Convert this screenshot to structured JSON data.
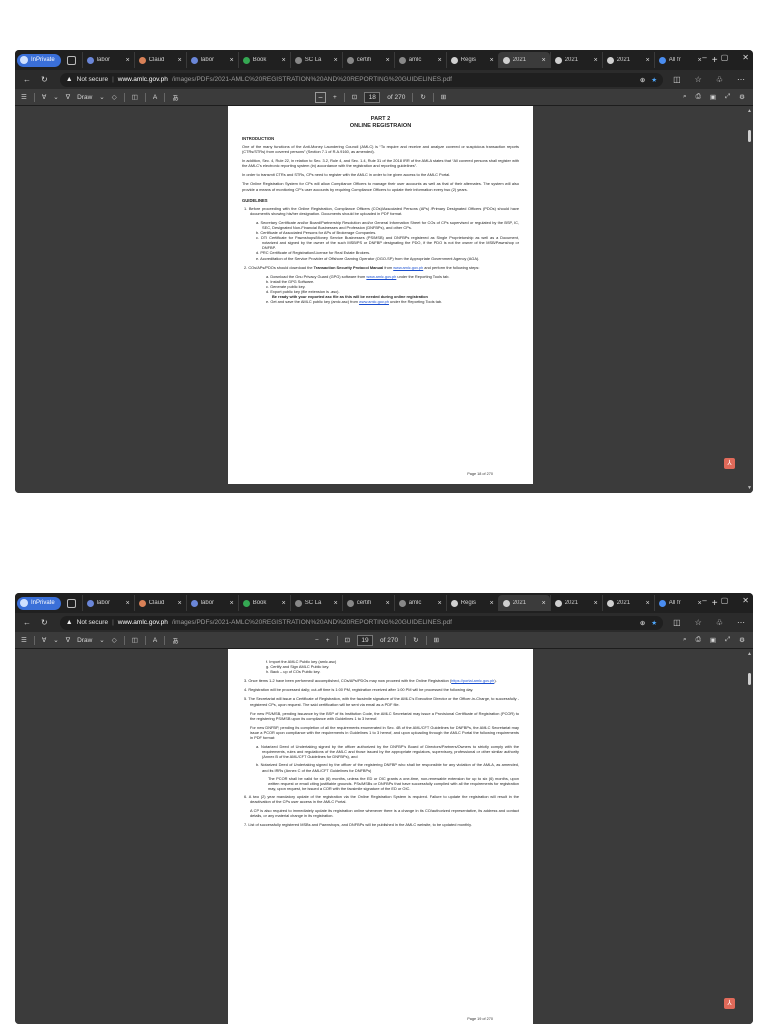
{
  "browser": {
    "profile_label": "InPrivate",
    "tabs": [
      {
        "title": "labor",
        "color": "#6a86d8"
      },
      {
        "title": "Claud",
        "color": "#d98157"
      },
      {
        "title": "labor",
        "color": "#6a86d8"
      },
      {
        "title": "Book",
        "color": "#35a853"
      },
      {
        "title": "SC La",
        "color": "#888888"
      },
      {
        "title": "certifi",
        "color": "#888888"
      },
      {
        "title": "amlc",
        "color": "#888888"
      },
      {
        "title": "Regis",
        "color": "#d0d0d0"
      },
      {
        "title": "2021",
        "color": "#d0d0d0"
      },
      {
        "title": "2021",
        "color": "#d0d0d0"
      },
      {
        "title": "2021",
        "color": "#d0d0d0"
      },
      {
        "title": "All fr",
        "color": "#4a8df0"
      }
    ],
    "new_tab": "+",
    "tab_close": "×",
    "win_min": "–",
    "win_max": "▢",
    "win_close": "✕",
    "not_secure": "Not secure",
    "url_host": "www.amlc.gov.ph",
    "url_path": "/images/PDFs/2021-AMLC%20REGISTRATION%20AND%20REPORTING%20GUIDELINES.pdf"
  },
  "pdf_toolbar": {
    "draw_label": "Draw",
    "zoom_out": "−",
    "zoom_in": "+",
    "page_of_top": "of 270",
    "page_of_bottom": "of 270",
    "current_page_top": "18",
    "current_page_bottom": "19"
  },
  "page18": {
    "part": "PART 2",
    "title": "ONLINE REGISTRAION",
    "intro_heading": "INTRODUCTION",
    "intro_p1": "One of the many functions of the Anti-Money Laundering Council (AMLC) is “To require and receive and analyze covered or suspicious transaction reports (CTRs/STRs) from covered persons” (Section 7.1 of R.A.9160, as amended).",
    "intro_p2": "In addition, Sec. 4, Rule 22, in relation to Sec. 3.2, Rule 4, and Sec. 1.4, Rule 31 of the 2018 IRR of the AMLA states that “All covered persons shall register with the AMLC’s electronic reporting system (in) accordance with the registration and reporting guidelines”.",
    "intro_p3": "In order to transmit CTRs and STRs, CPs need to register with the AMLC in order to be given access to the AMLC Portal.",
    "intro_p4": "The Online Registration System for CPs will allow Compliance Officers to manage their user accounts as well as that of their alternates. The system will also provide a means of monitoring CP’s user accounts by requiring Compliance Officers to update their information every two (2) years.",
    "guide_heading": "GUIDELINES",
    "g1": "1.  Before proceeding with the Online Registration, Compliance Officers (COs)/Associated Persons (APs) /Primary Designated Officers (PDOs) should have document/s showing his/her designation. Documents should be uploaded in PDF format.",
    "g1a": "a.  Secretary Certificate and/or Board/Partnership Resolution and/or General Information Sheet for COs of CPs supervised or regulated by the BSP, IC, SEC, Designated Non-Financial Businesses and Profession (DNFBPs), and other CPs.",
    "g1b": "b.  Certificate of Associated Persons for APs of Brokerage Companies.",
    "g1c": "c.  DTI Certificate for Pawnshops/Money Service Businesses (PS/MSB) and DNFBPs registered as Single Proprietorship as well as a Document, notarized and signed by the owner of the such MSB/PS or DNFBP designating the PDO, if the PDO is not the owner of the MSB/Pawnshop or DNFBP.",
    "g1d": "d.  PRC Certificate of Registration/License for Real Estate Brokers.",
    "g1e": "e.  Accreditation of the Service Provider of Offshore Gaming Operator (OGO-SP) from the Appropriate Government Agency (AGA).",
    "g2_pre": "2.  COs/APs/PDOs should download the ",
    "g2_bold": "Transaction Security Protocol Manual",
    "g2_mid": " from ",
    "g2_link": "www.amlc.gov.ph",
    "g2_post": " and perform the following steps:",
    "g2a_pre": "a.  Download the Gnu Privacy Guard (GPG) software from ",
    "g2a_link": "www.amlc.gov.ph",
    "g2a_post": " under the Reporting Tools tab.",
    "g2b": "b.  Install the GPG Software.",
    "g2c": "c.  Generate public key.",
    "g2d": "d.  Export public key (file extension is .asc).",
    "g2d_bold": "Be ready with your exported asc file as this will be needed during online registration",
    "g2e_pre": "e.  Get and save the AMLC public key (amlc.asc) from ",
    "g2e_link": "www.amlc.gov.ph",
    "g2e_post": " under the Reporting Tools tab.",
    "page_footer": "Page 18 of 270"
  },
  "page19": {
    "f": "f.  Import the AMLC Public key (amlc.asc)",
    "g": "g.  Certify and Sign AMLC Public key.",
    "h": "h.  Back – up of COs Public key.",
    "s3_pre": "3.  Once items 1-2 have been performed/ accomplished, COs/APs/PDOs may now proceed with the Online Registration (",
    "s3_link": "https://portal.amlc.gov.ph",
    "s3_post": ").",
    "s4": "4.  Registration will be processed daily; cut-off time is 1:00 PM, registration received after 1:00 PM will be processed the following day.",
    "s5": "5.  The Secretariat will issue a Certificate of Registration, with the facsimile signature of the AMLC’s Executive Director or the Officer-in-Charge, to successfully -registered CPs, upon request. The said certification will be sent via email as a PDF file.",
    "s5_p2": "For new PS/MSB, pending issuance by the BSP of its Institution Code, the AMLC Secretariat may issue a Provisional Certificate of Registration (PCOR) to the registering PS/MSB upon its compliance with Guidelines 1 to 3 hereof.",
    "s5_p3": "For new DNFBP, pending its completion of all the requirements enumerated in Sec. 4B of the AML/CFT Guidelines for DNFBPs, the AMLC Secretariat may issue a PCOR upon compliance with the requirements in Guidelines 1 to 3 hereof, and upon uploading through the AMLC Portal the following requirements in PDF format:",
    "s5a": "a.  Notarized Deed of Undertaking signed by the officer authorized by the DNFBP’s Board of Directors/Partners/Owners to strictly comply with the requirements, rules and regulations of the AMLC and those issued by the appropriate regulators, supervisory, professional or other similar authority (Annex B of the AML/CFT Guidelines for DNFBPs), and",
    "s5b": "b.  Notarized Deed of Undertaking signed by the officer of the registering DNFBP who shall be responsible for any violation of the AMLA, as amended, and its IRRs (Annex C of the AML/CFT Guidelines for DNFBPs)",
    "s5b_p": "The PCOR shall be valid for six (6) months, unless the ED or OIC grants a one-time, non-renewable extension for up to six (6) months, upon written request or email citing justifiable grounds. PSs/MSBs or DNFBPs that have successfully complied with all the requirements for registration may, upon request, be issued a COR with the facsimile signature of the ED or OIC.",
    "s6": "6.  A two (2) year mandatory update of the registration via the Online Registration System is required. Failure to update the registration will result in the deactivation of the CPs user access in the AMLC Portal.",
    "s6_p": "A CP is also required to immediately update its registration online whenever there is a change in its CO/authorized representative, its address and contact details, or any material change in its registration.",
    "s7": "7.  List of successfully registered MSBs and Pawnshops, and DNFBPs will be published in the AMLC website, to be updated monthly.",
    "page_footer": "Page 19 of 270"
  }
}
